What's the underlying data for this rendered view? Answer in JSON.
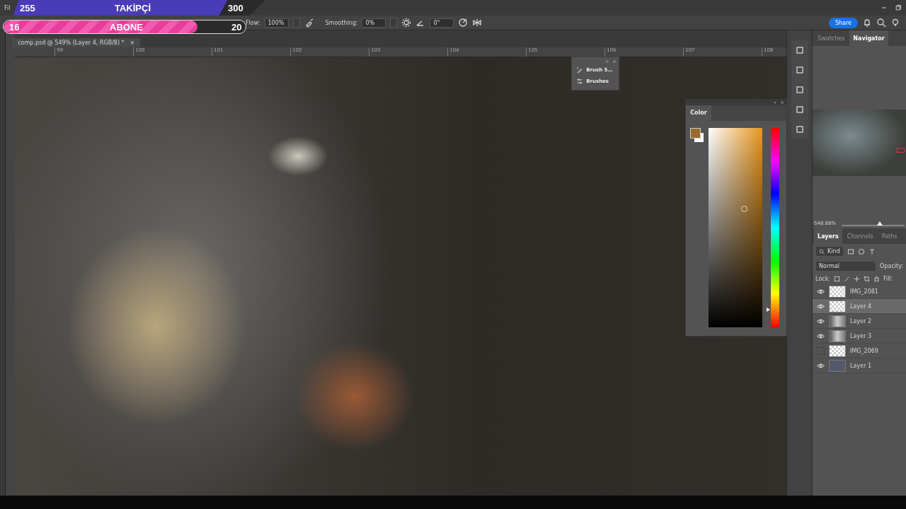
{
  "overlay": {
    "followers": {
      "current": "255",
      "label": "TAKİPÇİ",
      "goal": "300",
      "level": 0.85
    },
    "subscribers": {
      "current": "16",
      "label": "ABONE",
      "goal": "20",
      "level": 0.8
    }
  },
  "menu_bar": {
    "items": [
      "Fil"
    ]
  },
  "options_bar": {
    "flow_label": "Flow:",
    "flow": "100%",
    "smoothing_label": "Smoothing:",
    "smoothing": "0%",
    "angle": "0°",
    "share": "Share"
  },
  "document_tab": {
    "title": "comp.psd @ 549% (Layer 4, RGB/8) *",
    "close": "×"
  },
  "ruler": {
    "marks": [
      "99",
      "100",
      "101",
      "102",
      "103",
      "104",
      "105",
      "106",
      "107",
      "108"
    ]
  },
  "brush_panel": {
    "items": [
      "Brush S…",
      "Brushes"
    ]
  },
  "color_panel": {
    "title": "Color",
    "hue_slider": {
      "level": 0.09
    }
  },
  "navigator_panel": {
    "tabs": [
      {
        "label": "Swatches",
        "selected": false
      },
      {
        "label": "Navigator",
        "selected": true
      }
    ],
    "zoom": "548.68%",
    "zoom_slider": {
      "level": 0.6
    }
  },
  "layers_panel": {
    "tabs": [
      {
        "label": "Layers",
        "selected": true
      },
      {
        "label": "Channels",
        "selected": false
      },
      {
        "label": "Paths",
        "selected": false
      }
    ],
    "filter": "Kind",
    "blend_mode": "Normal",
    "opacity_label": "Opacity:",
    "lock_label": "Lock:",
    "fill_label": "Fill:",
    "layers": [
      {
        "name": "IMG_2081",
        "visible": true,
        "selected": false,
        "kind": "transparent"
      },
      {
        "name": "Layer 4",
        "visible": true,
        "selected": true,
        "kind": "transparent"
      },
      {
        "name": "Layer 2",
        "visible": true,
        "selected": false,
        "kind": "image"
      },
      {
        "name": "Layer 3",
        "visible": true,
        "selected": false,
        "kind": "image"
      },
      {
        "name": "IMG_2069",
        "visible": false,
        "selected": false,
        "kind": "transparent"
      },
      {
        "name": "Layer 1",
        "visible": true,
        "selected": false,
        "kind": "solid"
      }
    ]
  }
}
